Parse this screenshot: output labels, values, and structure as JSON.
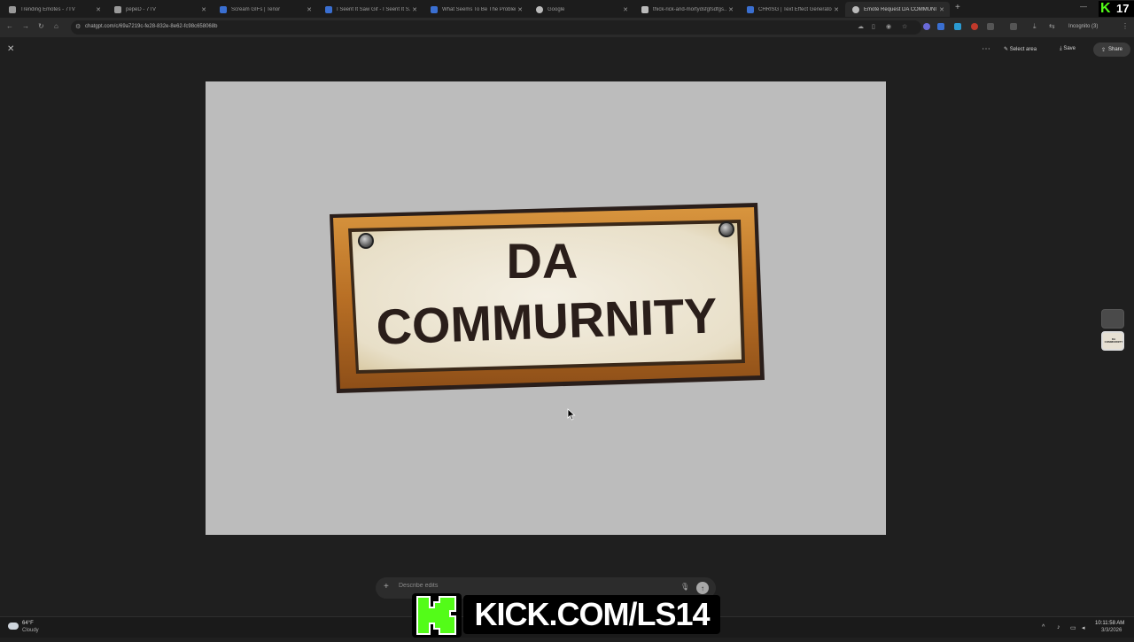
{
  "browser": {
    "tabs": [
      {
        "title": "Trending Emotes - 7TV",
        "favicon_color": "#9a9a9a",
        "active": false
      },
      {
        "title": "pepeD - 7TV",
        "favicon_color": "#9a9a9a",
        "active": false
      },
      {
        "title": "Scream GIFs | Tenor",
        "favicon_color": "#3a6fd1",
        "active": false
      },
      {
        "title": "I Seent It Saw Gif - I Seent It S...",
        "favicon_color": "#3a6fd1",
        "active": false
      },
      {
        "title": "What Seems To Be The Problem...",
        "favicon_color": "#3a6fd1",
        "active": false
      },
      {
        "title": "Google",
        "favicon_color": "#bbbbbb",
        "active": false
      },
      {
        "title": "thick-rick-and-mortydsfgfsdfgs...",
        "favicon_color": "#bbbbbb",
        "active": false
      },
      {
        "title": "CHRISG | Text Effect Generator",
        "favicon_color": "#3a6fd1",
        "active": false
      },
      {
        "title": "Emote Request DA COMMUNITY",
        "favicon_color": "#bbbbbb",
        "active": true
      }
    ],
    "url": "chatgpt.com/c/69a7219c-fe28-832e-8e62-fc98c658068b",
    "incognito_label": "Incognito (3)"
  },
  "viewer": {
    "select_area_label": "Select area",
    "save_label": "Save",
    "share_label": "Share",
    "image": {
      "sign_line1": "DA",
      "sign_line2": "COMMURNITY"
    },
    "thumbnail_text": "DA COMMURNITY"
  },
  "prompt": {
    "placeholder": "Describe edits"
  },
  "taskbar": {
    "temperature": "64°F",
    "condition": "Cloudy",
    "time": "10:11:58 AM",
    "date": "3/3/2026"
  },
  "overlay": {
    "kick_url": "KICK.COM/LS14",
    "badge_number": "17"
  },
  "colors": {
    "kick_green": "#53fc18",
    "page_bg": "#1f1f1f",
    "image_bg": "#bcbcbc",
    "wood": "#c0792a",
    "parchment": "#ede6d6",
    "ink": "#2a1e1a"
  }
}
